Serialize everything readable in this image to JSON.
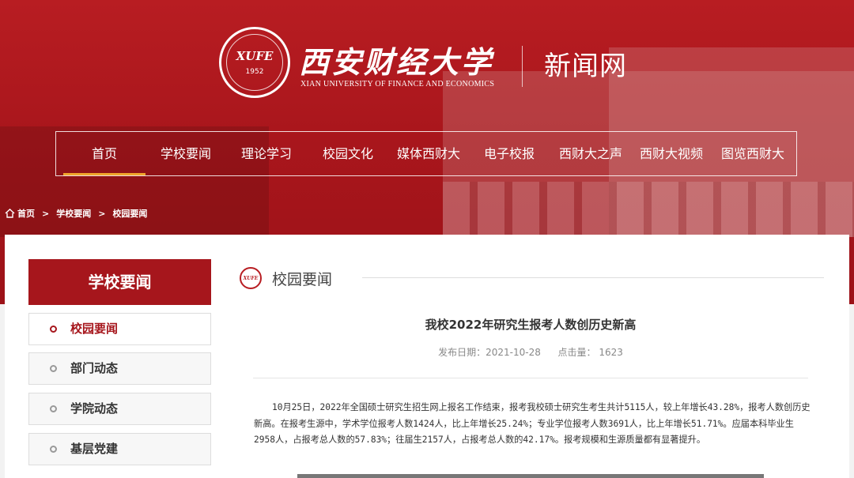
{
  "header": {
    "seal_abbr": "XUFE",
    "seal_year": "1952",
    "university_name_cn": "西安财经大学",
    "university_name_en": "XIAN UNIVERSITY OF FINANCE AND ECONOMICS",
    "site_title": "新闻网"
  },
  "nav": {
    "items": [
      {
        "label": "首页",
        "active": true
      },
      {
        "label": "学校要闻"
      },
      {
        "label": "理论学习"
      },
      {
        "label": "校园文化"
      },
      {
        "label": "媒体西财大"
      },
      {
        "label": "电子校报"
      },
      {
        "label": "西财大之声"
      },
      {
        "label": "西财大视频"
      },
      {
        "label": "图览西财大"
      }
    ]
  },
  "breadcrumb": {
    "icon": "home-icon",
    "items": [
      "首页",
      "学校要闻",
      "校园要闻"
    ],
    "separator": ">"
  },
  "sidebar": {
    "title": "学校要闻",
    "items": [
      {
        "label": "校园要闻",
        "active": true
      },
      {
        "label": "部门动态"
      },
      {
        "label": "学院动态"
      },
      {
        "label": "基层党建"
      }
    ]
  },
  "section": {
    "badge": "XUFE",
    "title": "校园要闻"
  },
  "article": {
    "title": "我校2022年研究生报考人数创历史新高",
    "date_label": "发布日期：",
    "date": "2021-10-28",
    "hits_label": "点击量：",
    "hits": "1623",
    "body": "10月25日，2022年全国硕士研究生招生网上报名工作结束，报考我校硕士研究生考生共计5115人，较上年增长43.28%，报考人数创历史新高。在报考生源中，学术学位报考人数1424人，比上年增长25.24%；专业学位报考人数3691人，比上年增长51.71%。应届本科毕业生2958人，占报考总人数的57.83%；往届生2157人，占报考总人数的42.17%。报考规模和生源质量都有显著提升。"
  },
  "colors": {
    "brand_red": "#a6161c",
    "nav_underline": "#f0a52c"
  }
}
